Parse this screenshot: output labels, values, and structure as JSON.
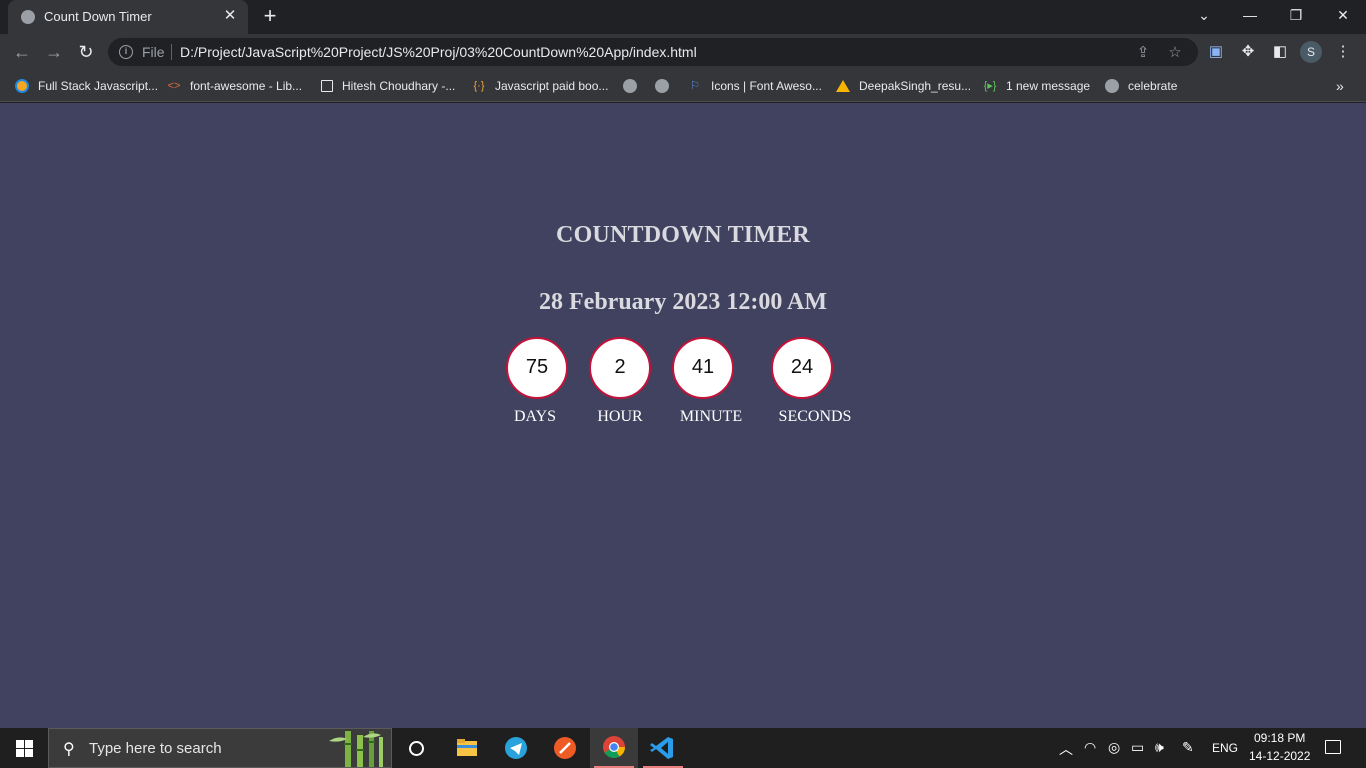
{
  "browser": {
    "tab_title": "Count Down Timer",
    "address": {
      "scheme_label": "File",
      "url": "D:/Project/JavaScript%20Project/JS%20Proj/03%20CountDown%20App/index.html"
    },
    "profile_initial": "S",
    "bookmarks": [
      {
        "label": "Full Stack Javascript...",
        "icon": "orange-circle-icon"
      },
      {
        "label": "font-awesome - Lib...",
        "icon": "code-brackets-icon"
      },
      {
        "label": "Hitesh Choudhary -...",
        "icon": "square-outline-icon"
      },
      {
        "label": "Javascript paid boo...",
        "icon": "braces-icon"
      },
      {
        "label": "",
        "icon": "globe-icon"
      },
      {
        "label": "",
        "icon": "globe-icon"
      },
      {
        "label": "Icons | Font Aweso...",
        "icon": "flag-icon"
      },
      {
        "label": "DeepakSingh_resu...",
        "icon": "google-drive-icon"
      },
      {
        "label": "1 new message",
        "icon": "message-icon"
      },
      {
        "label": "celebrate",
        "icon": "globe-icon"
      }
    ]
  },
  "page": {
    "title": "COUNTDOWN TIMER",
    "target_date": "28 February 2023 12:00 AM",
    "counters": [
      {
        "value": "75",
        "label": "DAYS"
      },
      {
        "value": "2",
        "label": "HOUR"
      },
      {
        "value": "41",
        "label": "MINUTE"
      },
      {
        "value": "24",
        "label": "SECONDS"
      }
    ],
    "colors": {
      "background": "#40425f",
      "circle_border": "#c4123a",
      "circle_fill": "#ffffff"
    }
  },
  "taskbar": {
    "search_placeholder": "Type here to search",
    "language": "ENG",
    "time": "09:18 PM",
    "date": "14-12-2022"
  }
}
